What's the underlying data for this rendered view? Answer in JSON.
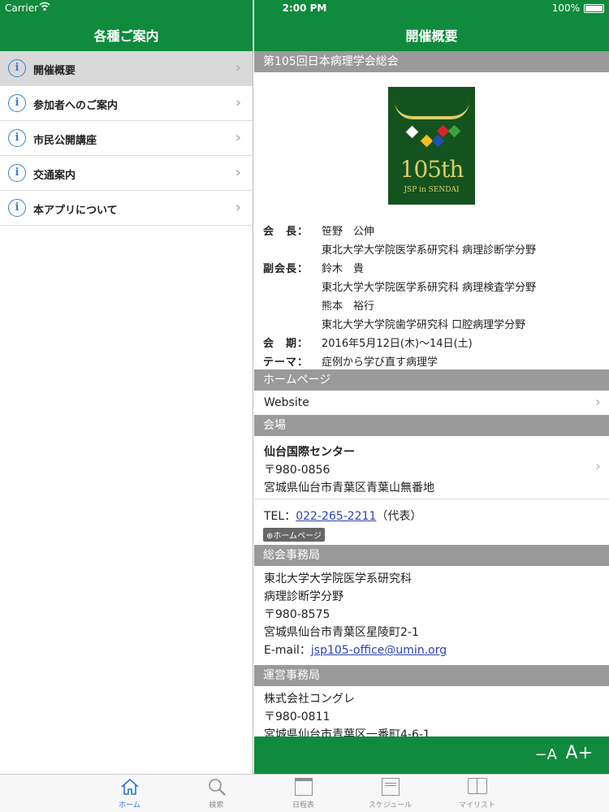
{
  "status_bar": {
    "carrier": "Carrier",
    "time": "2:00 PM",
    "battery": "100%"
  },
  "sidebar": {
    "title": "各種ご案内",
    "items": [
      {
        "label": "開催概要",
        "icon": "info-icon",
        "selected": true
      },
      {
        "label": "参加者へのご案内",
        "icon": "info-icon"
      },
      {
        "label": "市民公開講座",
        "icon": "info-icon"
      },
      {
        "label": "交通案内",
        "icon": "info-icon"
      },
      {
        "label": "本アプリについて",
        "icon": "info-icon"
      }
    ]
  },
  "detail": {
    "title": "開催概要",
    "event_title": "第105回日本病理学会総会",
    "logo": {
      "number": "105th",
      "subtitle": "JSP in SENDAI"
    },
    "info": [
      {
        "key": "会　長：",
        "value": "笹野　公伸"
      },
      {
        "key": "",
        "value": "東北大学大学院医学系研究科 病理診断学分野"
      },
      {
        "key": "副会長：",
        "value": "鈴木　貴"
      },
      {
        "key": "",
        "value": "東北大学大学院医学系研究科 病理検査学分野"
      },
      {
        "key": "",
        "value": "熊本　裕行"
      },
      {
        "key": "",
        "value": "東北大学大学院歯学研究科 口腔病理学分野"
      },
      {
        "key": "会　期：",
        "value": "2016年5月12日(木)～14日(土)"
      },
      {
        "key": "テーマ：",
        "value": "症例から学び直す病理学"
      }
    ],
    "homepage_section": "ホームページ",
    "website_label": "Website",
    "venue_section": "会場",
    "venue": {
      "name": "仙台国際センター",
      "zip": "〒980-0856",
      "address": "宮城県仙台市青葉区青葉山無番地",
      "tel_prefix": "TEL：",
      "tel": "022-265-2211",
      "tel_suffix": "（代表）",
      "homepage_badge": "⊕ホームページ"
    },
    "office_section": "総会事務局",
    "office": {
      "line1": "東北大学大学院医学系研究科",
      "line2": "病理診断学分野",
      "zip": "〒980-8575",
      "address": "宮城県仙台市青葉区星陵町2-1",
      "email_prefix": "E-mail：",
      "email": "jsp105-office@umin.org"
    },
    "ops_section": "運営事務局",
    "ops": {
      "line1": "株式会社コングレ",
      "zip": "〒980-0811",
      "address": "宮城県仙台市青葉区一番町4-6-1"
    },
    "font_smaller": "−A",
    "font_larger": "A+"
  },
  "tabs": [
    {
      "label": "ホーム",
      "icon": "home-icon",
      "active": true
    },
    {
      "label": "検索",
      "icon": "search-icon"
    },
    {
      "label": "日程表",
      "icon": "calendar-icon"
    },
    {
      "label": "スケジュール",
      "icon": "schedule-icon"
    },
    {
      "label": "マイリスト",
      "icon": "book-icon"
    }
  ],
  "colors": {
    "accent": "#108a3c",
    "tab_active": "#2a76d2",
    "section_bar": "#9a9a9a",
    "link": "#2b3fb8"
  }
}
